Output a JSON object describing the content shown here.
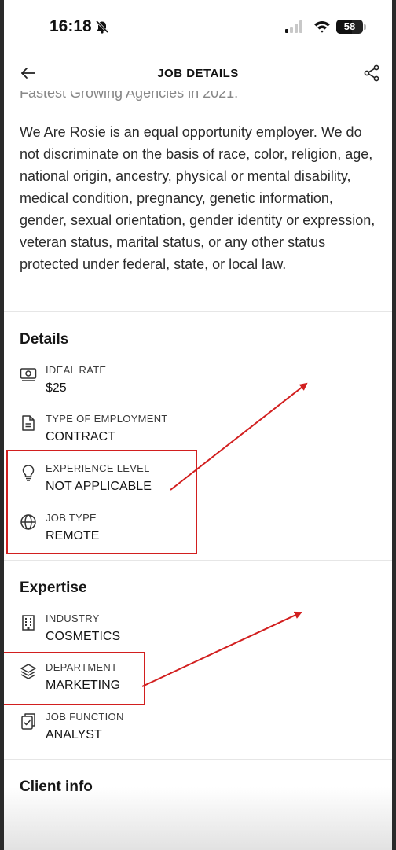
{
  "status_bar": {
    "time": "16:18",
    "battery": "58",
    "icons": [
      "bell-off-icon",
      "signal-icon",
      "wifi-icon",
      "battery-icon"
    ]
  },
  "nav": {
    "title": "JOB DETAILS",
    "back_icon": "arrow-left-icon",
    "share_icon": "share-icon"
  },
  "description": {
    "cut_line": "Fastest Growing Agencies in 2021.",
    "eeo": "We Are Rosie is an equal opportunity employer. We do not discriminate on the basis of race, color, religion, age, national origin, ancestry, physical or mental disability, medical condition, pregnancy, genetic information, gender, sexual orientation, gender identity or expression, veteran status, marital status, or any other status protected under federal, state, or local law."
  },
  "details": {
    "title": "Details",
    "items": [
      {
        "label": "IDEAL RATE",
        "value": "$25",
        "icon": "money-icon"
      },
      {
        "label": "TYPE OF EMPLOYMENT",
        "value": "CONTRACT",
        "icon": "document-icon"
      },
      {
        "label": "EXPERIENCE LEVEL",
        "value": "NOT APPLICABLE",
        "icon": "lightbulb-icon"
      },
      {
        "label": "JOB TYPE",
        "value": "REMOTE",
        "icon": "globe-icon"
      }
    ]
  },
  "expertise": {
    "title": "Expertise",
    "items": [
      {
        "label": "INDUSTRY",
        "value": "COSMETICS",
        "icon": "building-icon"
      },
      {
        "label": "DEPARTMENT",
        "value": "MARKETING",
        "icon": "layers-icon"
      },
      {
        "label": "JOB FUNCTION",
        "value": "ANALYST",
        "icon": "clipboard-icon"
      }
    ]
  },
  "client_info": {
    "title": "Client info"
  },
  "annotation_color": "#d21f1f"
}
